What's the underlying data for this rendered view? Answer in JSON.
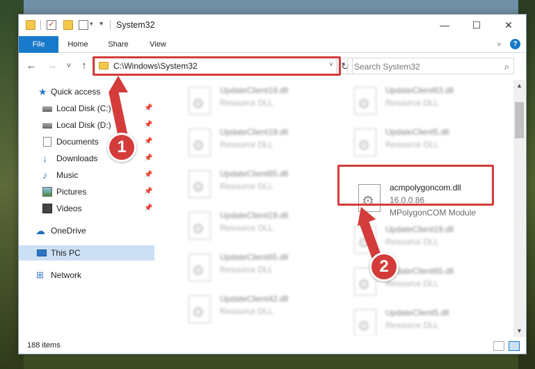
{
  "window": {
    "title": "System32"
  },
  "titlebar": {
    "minimize": "—",
    "maximize": "☐",
    "close": "✕"
  },
  "ribbon": {
    "tabs": [
      "File",
      "Home",
      "Share",
      "View"
    ],
    "help": "?"
  },
  "navigation": {
    "back": "←",
    "forward": "→",
    "recent": "˅",
    "up": "↑",
    "address": "C:\\Windows\\System32",
    "refresh": "↻",
    "search_placeholder": "Search System32",
    "search_glyph": "⌕"
  },
  "sidebar": {
    "items": [
      {
        "label": "Quick access",
        "icon": "star-icon"
      },
      {
        "label": "Local Disk (C:)",
        "icon": "disk-icon",
        "pinned": true
      },
      {
        "label": "Local Disk (D:)",
        "icon": "disk-icon",
        "pinned": true
      },
      {
        "label": "Documents",
        "icon": "documents-icon",
        "pinned": true
      },
      {
        "label": "Downloads",
        "icon": "download-icon",
        "pinned": true
      },
      {
        "label": "Music",
        "icon": "music-icon",
        "pinned": true
      },
      {
        "label": "Pictures",
        "icon": "pictures-icon",
        "pinned": true
      },
      {
        "label": "Videos",
        "icon": "videos-icon",
        "pinned": true
      },
      {
        "label": "OneDrive",
        "icon": "onedrive-icon"
      },
      {
        "label": "This PC",
        "icon": "pc-icon",
        "selected": true
      },
      {
        "label": "Network",
        "icon": "network-icon"
      }
    ],
    "pin_glyph": "📌"
  },
  "files": [
    {
      "name": "UpdateClient19.dll",
      "type": "Resource DLL"
    },
    {
      "name": "UpdateClient63.dll",
      "type": "Resource DLL"
    },
    {
      "name": "UpdateClient19.dll",
      "type": "Resource DLL"
    },
    {
      "name": "UpdateClient5.dll",
      "type": "Resource DLL"
    },
    {
      "name": "UpdateClient65.dll",
      "type": "Resource DLL"
    },
    {
      "name": "acmpolygoncom.dll",
      "version": "16.0.0.86",
      "description": "MPolygonCOM Module",
      "highlighted": true
    },
    {
      "name": "UpdateClient19.dll",
      "type": "Resource DLL"
    },
    {
      "name": "UpdateClient19.dll",
      "type": "Resource DLL"
    },
    {
      "name": "UpdateClient65.dll",
      "type": "Resource DLL"
    },
    {
      "name": "UpdateClient65.dll",
      "type": "Resource DLL"
    },
    {
      "name": "UpdateClient42.dll",
      "type": "Resource DLL"
    },
    {
      "name": "UpdateClient5.dll",
      "type": "Resource DLL"
    }
  ],
  "status": {
    "item_count": "188 items"
  },
  "annotations": {
    "step1": "1",
    "step2": "2",
    "color": "#d43b3b"
  },
  "colors": {
    "accent": "#1979ca",
    "selection": "#cce0f5",
    "annotation": "#d43b3b"
  }
}
